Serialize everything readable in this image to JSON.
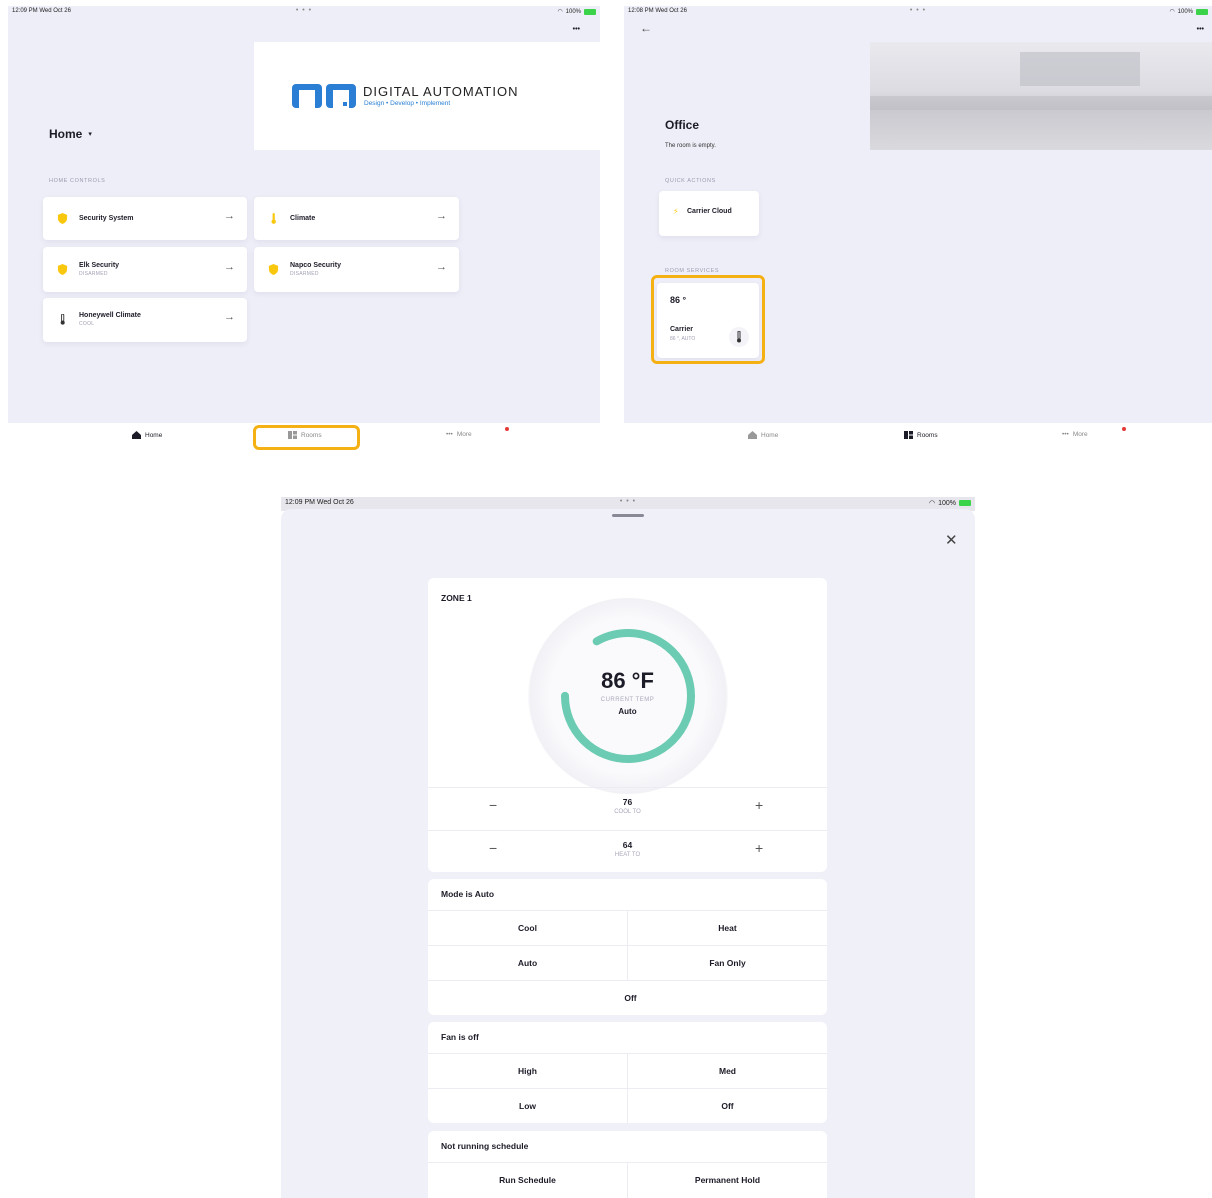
{
  "colors": {
    "accent": "#f5b014",
    "gauge": "#6ccbb3",
    "bg": "#eeeef8",
    "shield": "#f9c80e"
  },
  "screen1": {
    "status": {
      "time": "12:09 PM  Wed Oct 26",
      "battery": "100%"
    },
    "menu": "•••",
    "logo": {
      "title": "DIGITAL AUTOMATION",
      "tagline": "Design • Develop • Implement"
    },
    "home_title": "Home",
    "section": "HOME CONTROLS",
    "controls": [
      {
        "title": "Security System",
        "sub": "",
        "icon": "shield-icon"
      },
      {
        "title": "Climate",
        "sub": "",
        "icon": "thermometer-icon"
      },
      {
        "title": "Elk Security",
        "sub": "DISARMED",
        "icon": "shield-icon"
      },
      {
        "title": "Napco Security",
        "sub": "DISARMED",
        "icon": "shield-icon"
      },
      {
        "title": "Honeywell Climate",
        "sub": "COOL",
        "icon": "thermometer-icon"
      }
    ],
    "tabs": {
      "home": "Home",
      "rooms": "Rooms",
      "more": "More"
    }
  },
  "screen2": {
    "status": {
      "time": "12:08 PM  Wed Oct 26",
      "battery": "100%"
    },
    "menu": "•••",
    "room_title": "Office",
    "room_sub": "The room is empty.",
    "quick_label": "QUICK ACTIONS",
    "quick_action": "Carrier Cloud",
    "services_label": "ROOM SERVICES",
    "service": {
      "temp": "86 °",
      "name": "Carrier",
      "sub": "86 °, AUTO"
    },
    "tabs": {
      "home": "Home",
      "rooms": "Rooms",
      "more": "More"
    }
  },
  "screen3": {
    "status": {
      "time": "12:09 PM  Wed Oct 26",
      "battery": "100%"
    },
    "zone": "ZONE 1",
    "temp": "86 °F",
    "temp_caption": "CURRENT TEMP",
    "mode_value": "Auto",
    "cool_to": {
      "value": "76",
      "label": "COOL TO"
    },
    "heat_to": {
      "value": "64",
      "label": "HEAT TO"
    },
    "mode_header": "Mode is Auto",
    "modes": [
      "Cool",
      "Heat",
      "Auto",
      "Fan Only",
      "Off"
    ],
    "fan_header": "Fan is off",
    "fans": [
      "High",
      "Med",
      "Low",
      "Off"
    ],
    "schedule_header": "Not running schedule",
    "schedule": [
      "Run Schedule",
      "Permanent Hold"
    ]
  }
}
